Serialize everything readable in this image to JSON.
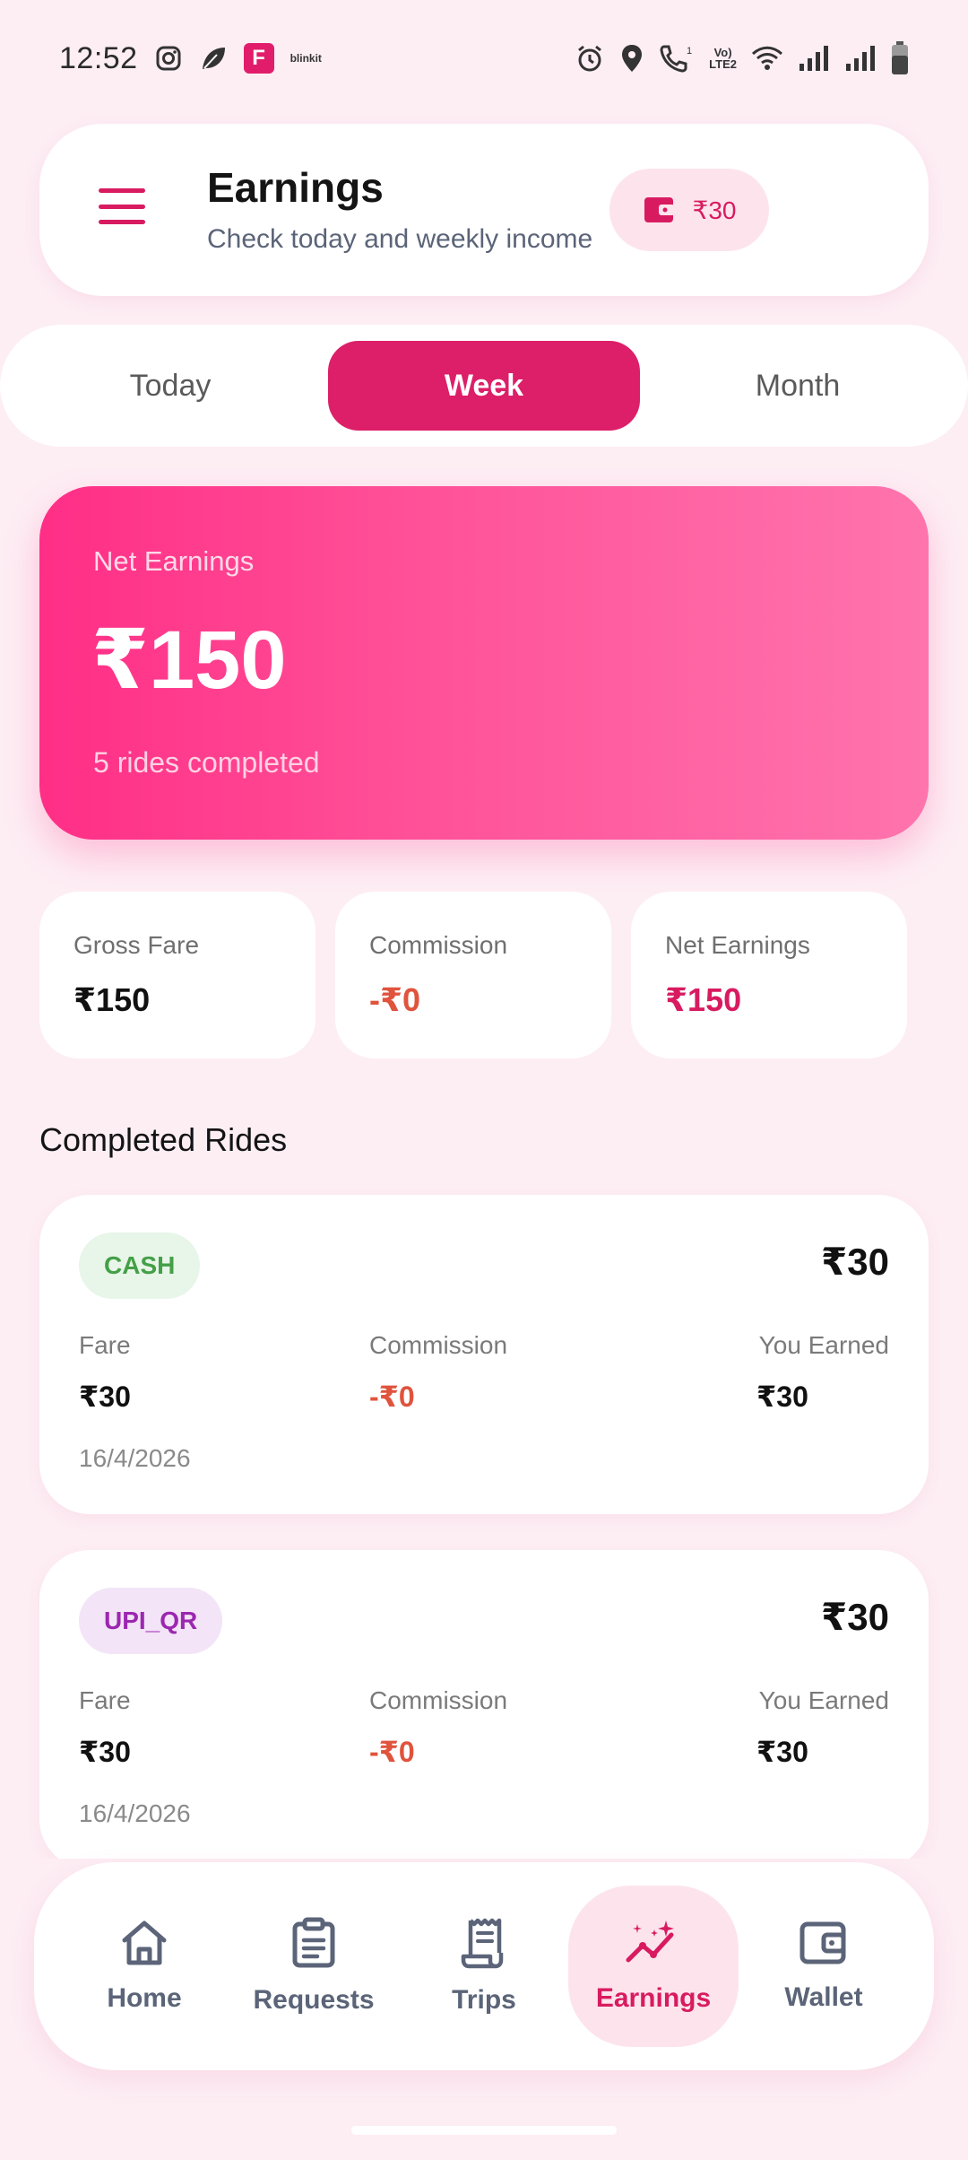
{
  "status_bar": {
    "time": "12:52",
    "blinkit": "blinkit",
    "app_f": "F",
    "volte_top": "Vo)",
    "volte_bottom": "LTE2",
    "sim_index": "1"
  },
  "header": {
    "title": "Earnings",
    "subtitle": "Check today and weekly income",
    "wallet_balance": "₹30"
  },
  "tabs": [
    {
      "label": "Today",
      "active": false
    },
    {
      "label": "Week",
      "active": true
    },
    {
      "label": "Month",
      "active": false
    }
  ],
  "summary": {
    "label": "Net Earnings",
    "amount": "₹150",
    "rides_completed": "5 rides completed"
  },
  "stats": [
    {
      "label": "Gross Fare",
      "value": "₹150"
    },
    {
      "label": "Commission",
      "value": "-₹0"
    },
    {
      "label": "Net Earnings",
      "value": "₹150"
    }
  ],
  "section_title": "Completed Rides",
  "rides": [
    {
      "payment": "CASH",
      "amount": "₹30",
      "fare_label": "Fare",
      "fare": "₹30",
      "commission_label": "Commission",
      "commission": "-₹0",
      "earned_label": "You Earned",
      "earned": "₹30",
      "date": "16/4/2026"
    },
    {
      "payment": "UPI_QR",
      "amount": "₹30",
      "fare_label": "Fare",
      "fare": "₹30",
      "commission_label": "Commission",
      "commission": "-₹0",
      "earned_label": "You Earned",
      "earned": "₹30",
      "date": "16/4/2026"
    }
  ],
  "nav": [
    {
      "label": "Home",
      "icon": "home-icon",
      "active": false
    },
    {
      "label": "Requests",
      "icon": "clipboard-icon",
      "active": false
    },
    {
      "label": "Trips",
      "icon": "receipt-icon",
      "active": false
    },
    {
      "label": "Earnings",
      "icon": "trend-sparkle-icon",
      "active": true
    },
    {
      "label": "Wallet",
      "icon": "wallet-icon",
      "active": false
    }
  ],
  "colors": {
    "brand": "#d81b60",
    "hero_start": "#ff2e86",
    "hero_end": "#ff74ad",
    "background": "#fdeef4",
    "negative": "#e0533d",
    "cash": "#43a047",
    "upi": "#9c27b0"
  }
}
